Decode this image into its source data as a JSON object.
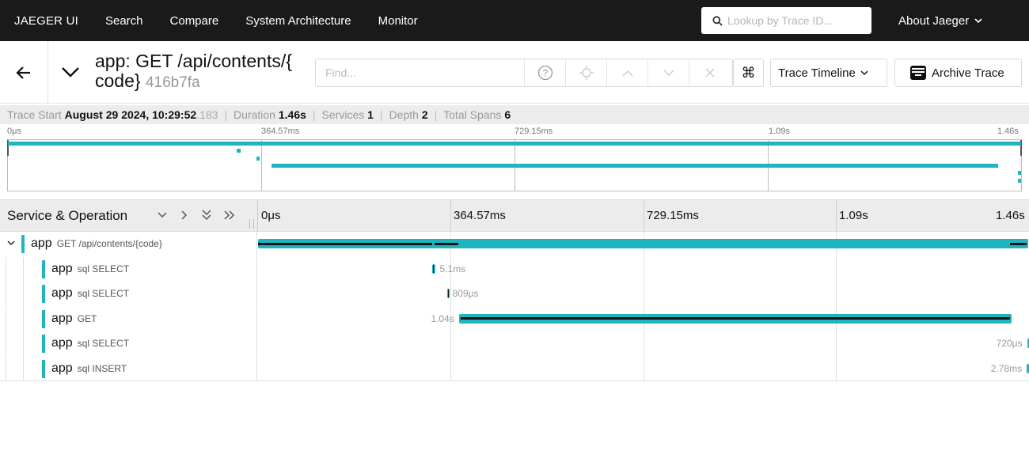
{
  "nav": {
    "brand": "JAEGER UI",
    "links": [
      "Search",
      "Compare",
      "System Architecture",
      "Monitor"
    ],
    "search_placeholder": "Lookup by Trace ID...",
    "about": "About Jaeger"
  },
  "trace": {
    "title_line1": "app: GET /api/contents/{",
    "title_line2": "code}",
    "trace_id": "416b7fa",
    "find_placeholder": "Find...",
    "view_mode": "Trace Timeline",
    "archive_label": "Archive Trace"
  },
  "summary": {
    "start_label": "Trace Start",
    "start_value": "August 29 2024, 10:29:52",
    "start_ms": ".183",
    "duration_label": "Duration",
    "duration_value": "1.46s",
    "services_label": "Services",
    "services_value": "1",
    "depth_label": "Depth",
    "depth_value": "2",
    "spans_label": "Total Spans",
    "spans_value": "6"
  },
  "ticks": [
    "0μs",
    "364.57ms",
    "729.15ms",
    "1.09s",
    "1.46s"
  ],
  "timeline": {
    "column_title": "Service & Operation"
  },
  "spans": [
    {
      "service": "app",
      "operation": "GET /api/contents/{code}",
      "depth": 0,
      "start_frac": 0.0,
      "end_frac": 1.0,
      "label": ""
    },
    {
      "service": "app",
      "operation": "sql SELECT",
      "depth": 1,
      "start_frac": 0.226,
      "end_frac": 0.2295,
      "label": "5.1ms"
    },
    {
      "service": "app",
      "operation": "sql SELECT",
      "depth": 1,
      "start_frac": 0.2455,
      "end_frac": 0.246,
      "label": "809μs"
    },
    {
      "service": "app",
      "operation": "GET",
      "depth": 1,
      "start_frac": 0.2605,
      "end_frac": 0.977,
      "label": "1.04s"
    },
    {
      "service": "app",
      "operation": "sql SELECT",
      "depth": 1,
      "start_frac": 0.9975,
      "end_frac": 0.998,
      "label": "720μs"
    },
    {
      "service": "app",
      "operation": "sql INSERT",
      "depth": 1,
      "start_frac": 0.997,
      "end_frac": 0.999,
      "label": "2.78ms"
    }
  ],
  "colors": {
    "service": "#1fb5bf",
    "critical_path": "#111111",
    "nav_bg": "#1a1a1a"
  }
}
